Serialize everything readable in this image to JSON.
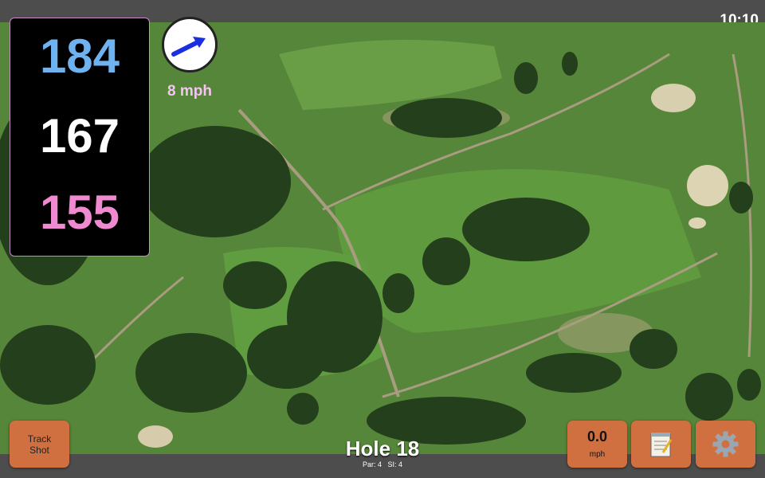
{
  "status_bar": {
    "time": "10:10"
  },
  "yardages": {
    "back": "184",
    "middle": "167",
    "front": "155"
  },
  "wind": {
    "speed_label": "8 mph",
    "direction_icon": "arrow-right-up-icon"
  },
  "buttons": {
    "track_shot_line1": "Track",
    "track_shot_line2": "Shot",
    "speed_value": "0.0",
    "speed_unit": "mph",
    "notes_icon": "notepad-icon",
    "settings_icon": "gear-icon"
  },
  "hole": {
    "title": "Hole 18",
    "par": "Par: 4",
    "si": "SI: 4"
  },
  "colors": {
    "back": "#6fb2f0",
    "middle": "#ffffff",
    "front": "#f08ad0",
    "button": "#d07040",
    "wind_label": "#f5c4f5"
  }
}
